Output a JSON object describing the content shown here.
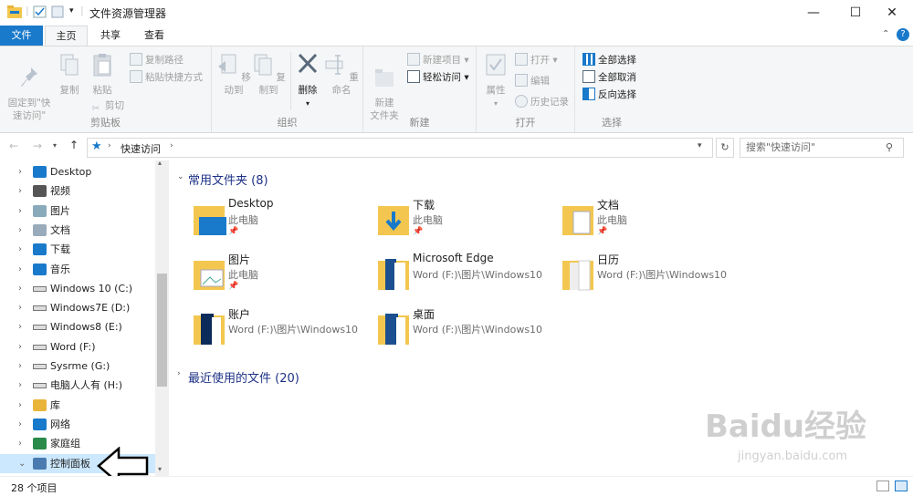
{
  "window": {
    "title": "文件资源管理器",
    "controls": [
      "—",
      "☐",
      "✕"
    ]
  },
  "ribbon_tabs": {
    "file": "文件",
    "home": "主页",
    "share": "共享",
    "view": "查看"
  },
  "ribbon": {
    "clipboard": {
      "label": "剪贴板",
      "pin": "固定到\"快\n速访问\"",
      "copy": "复制",
      "paste": "粘贴",
      "copy_path": "复制路径",
      "paste_shortcut": "粘贴快捷方式",
      "cut": "剪切"
    },
    "organize": {
      "label": "组织",
      "move_to": "移动到",
      "copy_to": "复制到",
      "delete": "删除",
      "rename": "重命名"
    },
    "new": {
      "label": "新建",
      "new_folder": "新建\n文件夹",
      "new_item": "新建项目",
      "easy_access": "轻松访问"
    },
    "open": {
      "label": "打开",
      "properties": "属性",
      "open": "打开",
      "edit": "编辑",
      "history": "历史记录"
    },
    "select": {
      "label": "选择",
      "select_all": "全部选择",
      "select_none": "全部取消",
      "invert": "反向选择"
    }
  },
  "nav": {
    "address": "快速访问",
    "search_placeholder": "搜索\"快速访问\""
  },
  "tree": [
    {
      "label": "Desktop",
      "icon": "desktop-icon"
    },
    {
      "label": "视频",
      "icon": "video-icon"
    },
    {
      "label": "图片",
      "icon": "pictures-icon"
    },
    {
      "label": "文档",
      "icon": "documents-icon"
    },
    {
      "label": "下载",
      "icon": "download-icon"
    },
    {
      "label": "音乐",
      "icon": "music-icon"
    },
    {
      "label": "Windows 10 (C:)",
      "icon": "drive-icon"
    },
    {
      "label": "Windows7E (D:)",
      "icon": "drive-icon"
    },
    {
      "label": "Windows8 (E:)",
      "icon": "drive-icon"
    },
    {
      "label": "Word (F:)",
      "icon": "drive-icon"
    },
    {
      "label": "Sysrme (G:)",
      "icon": "drive-icon"
    },
    {
      "label": "电脑人人有 (H:)",
      "icon": "drive-icon"
    },
    {
      "label": "库",
      "icon": "library-icon"
    },
    {
      "label": "网络",
      "icon": "network-icon"
    },
    {
      "label": "家庭组",
      "icon": "homegroup-icon"
    },
    {
      "label": "控制面板",
      "icon": "control-panel-icon"
    }
  ],
  "content": {
    "frequent_header": "常用文件夹 (8)",
    "recent_header": "最近使用的文件 (20)",
    "folders": [
      {
        "name": "Desktop",
        "sub": "此电脑",
        "pinned": "📌"
      },
      {
        "name": "下载",
        "sub": "此电脑",
        "pinned": "📌"
      },
      {
        "name": "文档",
        "sub": "此电脑",
        "pinned": "📌"
      },
      {
        "name": "图片",
        "sub": "此电脑",
        "pinned": "📌"
      },
      {
        "name": "Microsoft Edge",
        "sub": "Word (F:)\\图片\\Windows10",
        "pinned": ""
      },
      {
        "name": "日历",
        "sub": "Word (F:)\\图片\\Windows10",
        "pinned": ""
      },
      {
        "name": "账户",
        "sub": "Word (F:)\\图片\\Windows10",
        "pinned": ""
      },
      {
        "name": "桌面",
        "sub": "Word (F:)\\图片\\Windows10",
        "pinned": ""
      }
    ]
  },
  "status": {
    "count": "28 个项目"
  },
  "watermark": {
    "brand": "Baidu经验",
    "url": "jingyan.baidu.com"
  }
}
